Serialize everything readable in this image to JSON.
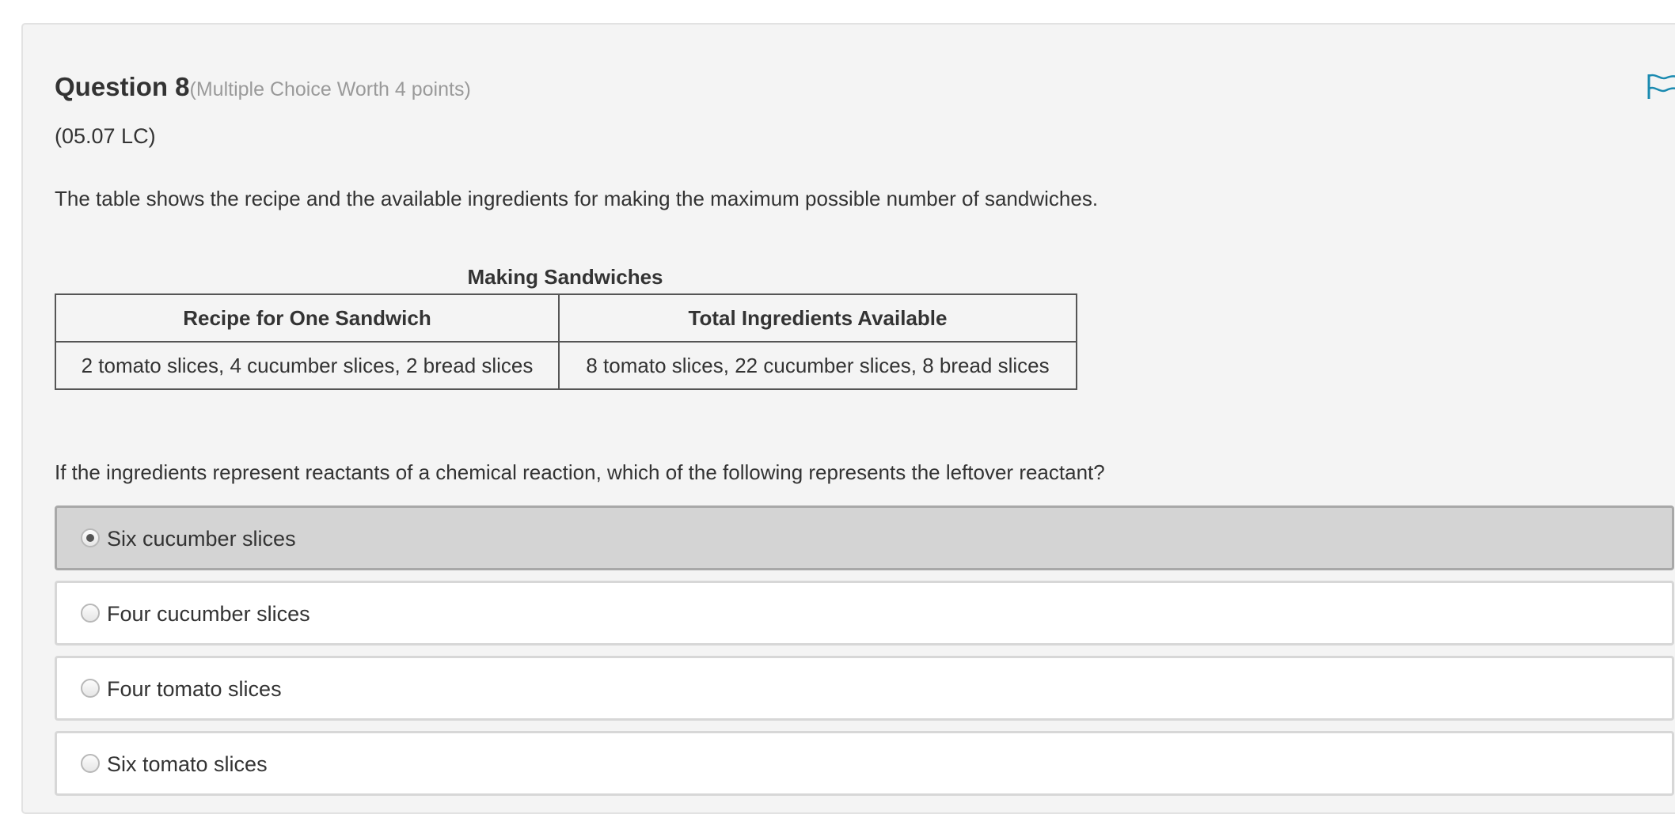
{
  "question": {
    "title": "Question 8",
    "worth": "(Multiple Choice Worth 4 points)",
    "code": "(05.07 LC)",
    "intro": "The table shows the recipe and the available ingredients for making the maximum possible number of sandwiches.",
    "prompt": "If the ingredients represent reactants of a chemical reaction, which of the following represents the leftover reactant?"
  },
  "table": {
    "caption": "Making Sandwiches",
    "headers": [
      "Recipe for One Sandwich",
      "Total Ingredients Available"
    ],
    "rows": [
      [
        "2 tomato slices, 4 cucumber slices, 2 bread slices",
        "8 tomato slices, 22 cucumber slices, 8 bread slices"
      ]
    ]
  },
  "choices": [
    {
      "label": "Six cucumber slices",
      "selected": true
    },
    {
      "label": "Four cucumber slices",
      "selected": false
    },
    {
      "label": "Four tomato slices",
      "selected": false
    },
    {
      "label": "Six tomato slices",
      "selected": false
    }
  ],
  "icons": {
    "flag": "flag-icon"
  },
  "colors": {
    "panel_bg": "#f4f4f4",
    "selected_bg": "#d4d4d4",
    "flag": "#1a8ab0",
    "muted_text": "#9a9a9a"
  }
}
